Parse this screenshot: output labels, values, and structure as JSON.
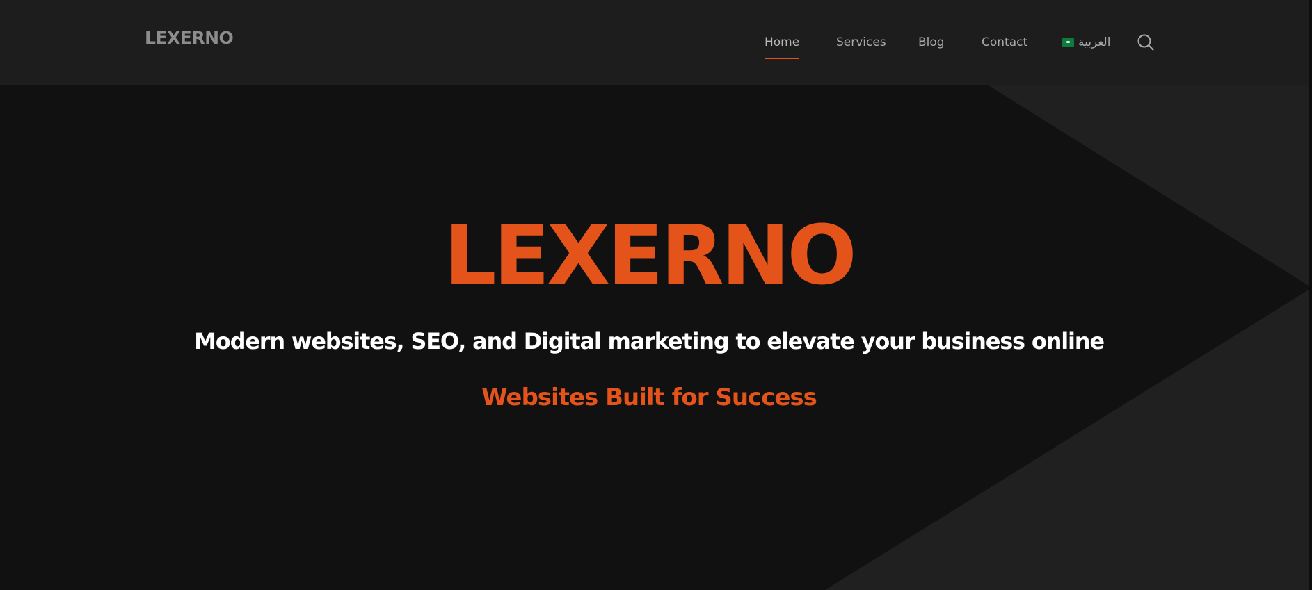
{
  "header": {
    "logo": "LEXERNO",
    "nav": [
      {
        "label": "Home",
        "active": true
      },
      {
        "label": "Services",
        "active": false
      },
      {
        "label": "Blog",
        "active": false
      },
      {
        "label": "Contact",
        "active": false
      }
    ],
    "language": {
      "label": "العربية",
      "flag_icon": "saudi-flag-icon"
    },
    "search_icon": "search-icon"
  },
  "hero": {
    "title": "LEXERNO",
    "subtitle": "Modern websites, SEO, and Digital marketing to elevate your business online",
    "tagline": "Websites Built for Success"
  },
  "colors": {
    "accent": "#e4541a",
    "header_bg": "#1d1d1d",
    "hero_dark": "#111111",
    "hero_light": "#202020",
    "nav_text": "#aaaaaa",
    "logo_text": "#8d8d8d",
    "subtitle_text": "#ffffff"
  }
}
